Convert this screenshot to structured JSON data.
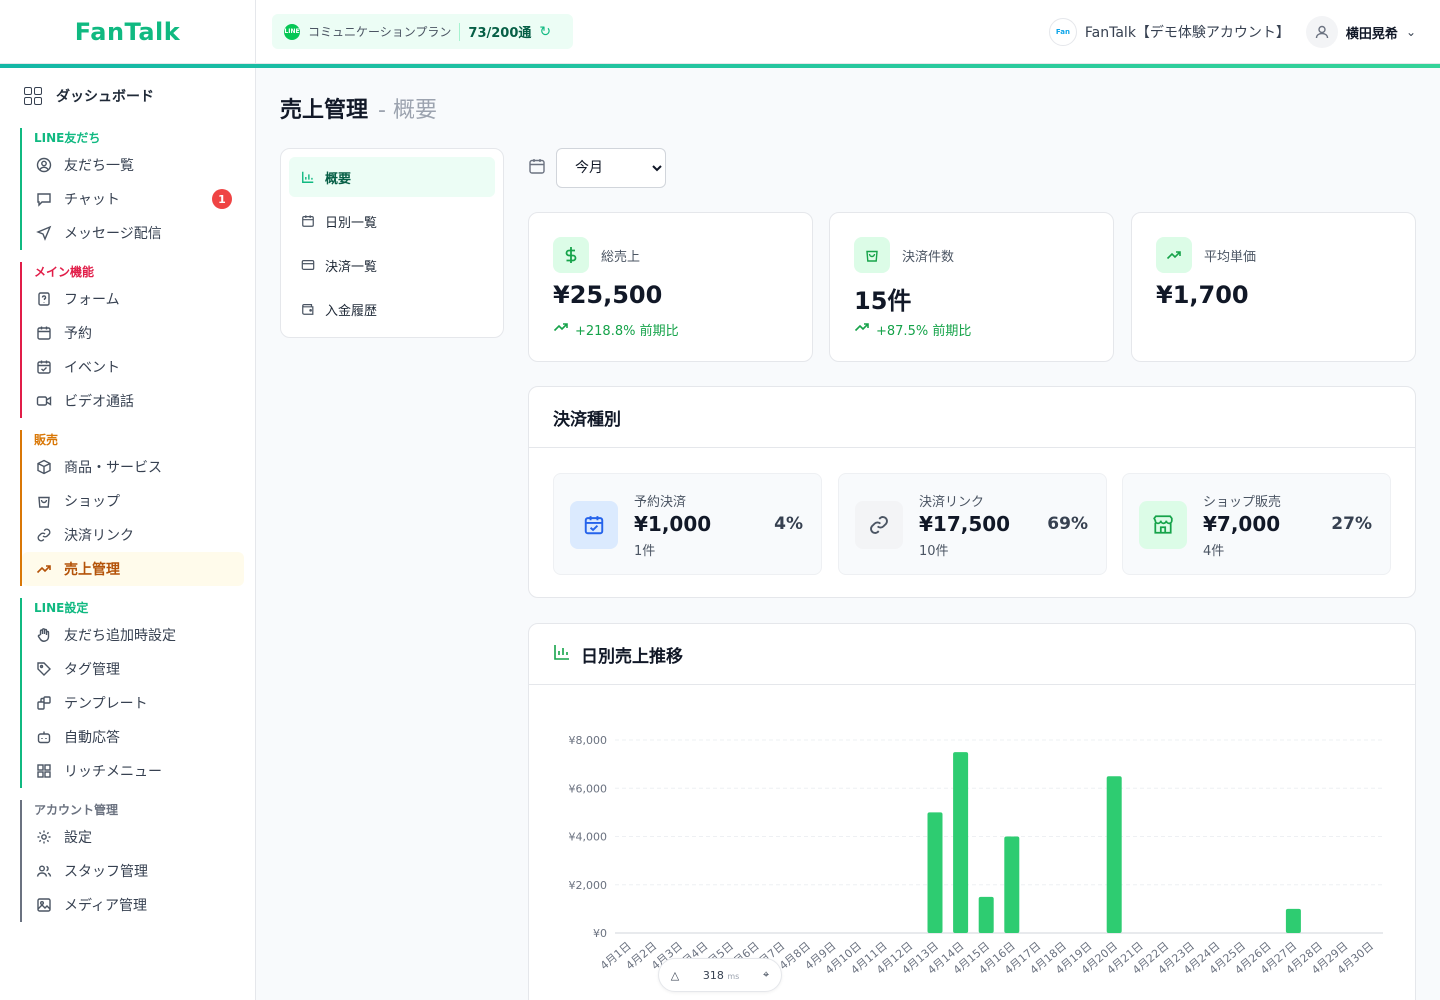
{
  "header": {
    "logo": "FanTalk",
    "plan_label": "コミュニケーションプラン",
    "plan_count": "73/200通",
    "account_name": "FanTalk【デモ体験アカウント】",
    "user_name": "横田晃希"
  },
  "sidebar": {
    "dashboard": "ダッシュボード",
    "groups": [
      {
        "label": "LINE友だち",
        "color": "#10b981",
        "items": [
          {
            "label": "友だち一覧",
            "icon": "user-circle-icon"
          },
          {
            "label": "チャット",
            "icon": "chat-icon",
            "badge": "1"
          },
          {
            "label": "メッセージ配信",
            "icon": "send-icon"
          }
        ]
      },
      {
        "label": "メイン機能",
        "color": "#e11d48",
        "items": [
          {
            "label": "フォーム",
            "icon": "form-icon"
          },
          {
            "label": "予約",
            "icon": "calendar-icon"
          },
          {
            "label": "イベント",
            "icon": "calendar-check-icon"
          },
          {
            "label": "ビデオ通話",
            "icon": "video-icon"
          }
        ]
      },
      {
        "label": "販売",
        "color": "#d97706",
        "items": [
          {
            "label": "商品・サービス",
            "icon": "box-icon"
          },
          {
            "label": "ショップ",
            "icon": "shopping-bag-icon"
          },
          {
            "label": "決済リンク",
            "icon": "link-icon"
          },
          {
            "label": "売上管理",
            "icon": "trending-up-icon",
            "active": true
          }
        ]
      },
      {
        "label": "LINE設定",
        "color": "#10b981",
        "items": [
          {
            "label": "友だち追加時設定",
            "icon": "hand-icon"
          },
          {
            "label": "タグ管理",
            "icon": "tag-icon"
          },
          {
            "label": "テンプレート",
            "icon": "template-icon"
          },
          {
            "label": "自動応答",
            "icon": "bot-icon"
          },
          {
            "label": "リッチメニュー",
            "icon": "grid-icon"
          }
        ]
      },
      {
        "label": "アカウント管理",
        "color": "#6b7280",
        "items": [
          {
            "label": "設定",
            "icon": "gear-icon"
          },
          {
            "label": "スタッフ管理",
            "icon": "users-icon"
          },
          {
            "label": "メディア管理",
            "icon": "image-icon"
          }
        ]
      }
    ]
  },
  "page": {
    "title": "売上管理",
    "subtitle": "- 概要"
  },
  "subnav": [
    {
      "label": "概要",
      "icon": "bar-chart-icon",
      "active": true
    },
    {
      "label": "日別一覧",
      "icon": "calendar-icon"
    },
    {
      "label": "決済一覧",
      "icon": "credit-card-icon"
    },
    {
      "label": "入金履歴",
      "icon": "wallet-icon"
    }
  ],
  "period": {
    "selected": "今月"
  },
  "stats": [
    {
      "label": "総売上",
      "value": "¥25,500",
      "change": "+218.8% 前期比",
      "icon": "dollar-icon"
    },
    {
      "label": "決済件数",
      "value": "15件",
      "change": "+87.5% 前期比",
      "icon": "shopping-bag-icon"
    },
    {
      "label": "平均単価",
      "value": "¥1,700",
      "change": "",
      "icon": "trending-up-icon"
    }
  ],
  "payment_types": {
    "title": "決済種別",
    "items": [
      {
        "name": "予約決済",
        "amount": "¥1,000",
        "count": "1件",
        "percent": "4%",
        "icon": "calendar-check-icon",
        "color": "#2563eb",
        "bg": "#dbeafe"
      },
      {
        "name": "決済リンク",
        "amount": "¥17,500",
        "count": "10件",
        "percent": "69%",
        "icon": "link-icon",
        "color": "#4b5563",
        "bg": "#f3f4f6"
      },
      {
        "name": "ショップ販売",
        "amount": "¥7,000",
        "count": "4件",
        "percent": "27%",
        "icon": "store-icon",
        "color": "#16a34a",
        "bg": "#dcfce7"
      }
    ]
  },
  "chart_title": "日別売上推移",
  "chart_data": {
    "type": "bar",
    "title": "日別売上推移",
    "categories": [
      "4月1日",
      "4月2日",
      "4月3日",
      "4月4日",
      "4月5日",
      "4月6日",
      "4月7日",
      "4月8日",
      "4月9日",
      "4月10日",
      "4月11日",
      "4月12日",
      "4月13日",
      "4月14日",
      "4月15日",
      "4月16日",
      "4月17日",
      "4月18日",
      "4月19日",
      "4月20日",
      "4月21日",
      "4月22日",
      "4月23日",
      "4月24日",
      "4月25日",
      "4月26日",
      "4月27日",
      "4月28日",
      "4月29日",
      "4月30日"
    ],
    "values": [
      0,
      0,
      0,
      0,
      0,
      0,
      0,
      0,
      0,
      0,
      0,
      0,
      5000,
      7500,
      1500,
      4000,
      0,
      0,
      0,
      6500,
      0,
      0,
      0,
      0,
      0,
      0,
      1000,
      0,
      0,
      0
    ],
    "ylim": [
      0,
      8000
    ],
    "yticks": [
      0,
      2000,
      4000,
      6000,
      8000
    ],
    "ytick_labels": [
      "¥0",
      "¥2,000",
      "¥4,000",
      "¥6,000",
      "¥8,000"
    ],
    "bar_color": "#2ecc71",
    "grid": true
  },
  "perf": {
    "value": "318",
    "unit": "ms"
  }
}
